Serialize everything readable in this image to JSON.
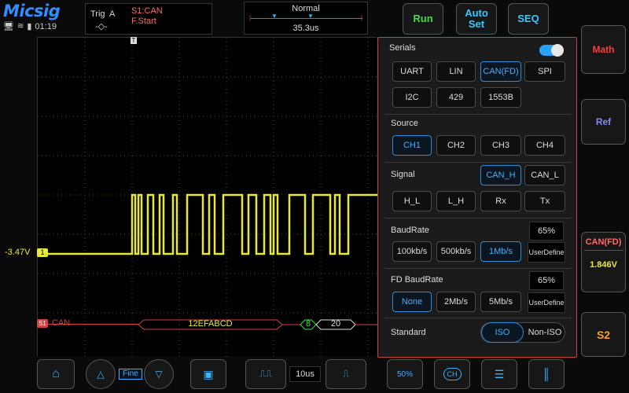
{
  "header": {
    "logo": "Micsig",
    "time": "01:19",
    "trigger": {
      "label": "Trig",
      "channel": "A",
      "source": "S1:CAN",
      "condition": "F.Start"
    },
    "timebase": {
      "mode": "Normal",
      "position": "35.3us"
    },
    "run_label": "Run",
    "autoset_label": "Auto\nSet",
    "seq_label": "SEQ"
  },
  "scope": {
    "ch1_offset": "-3.47V",
    "ch1_marker": "1",
    "serial_marker": "S1",
    "serial_name": "CAN",
    "decode": [
      "12EFABCD",
      "8",
      "20"
    ],
    "trigger_marker": "T"
  },
  "right": {
    "math": "Math",
    "ref": "Ref",
    "can_label": "CAN(FD)",
    "can_value": "1.846V",
    "s2": "S2"
  },
  "panel": {
    "serials_title": "Serials",
    "serials": [
      "UART",
      "LIN",
      "CAN(FD)",
      "SPI",
      "I2C",
      "429",
      "1553B"
    ],
    "source_title": "Source",
    "sources": [
      "CH1",
      "CH2",
      "CH3",
      "CH4"
    ],
    "signal_title": "Signal",
    "signals_top": [
      "CAN_H",
      "CAN_L"
    ],
    "signals_bottom": [
      "H_L",
      "L_H",
      "Rx",
      "Tx"
    ],
    "baud_title": "BaudRate",
    "baud_percent": "65%",
    "bauds": [
      "100kb/s",
      "500kb/s",
      "1Mb/s"
    ],
    "user_define": "UserDefine",
    "fd_title": "FD BaudRate",
    "fd_percent": "65%",
    "fd_bauds": [
      "None",
      "2Mb/s",
      "5Mb/s"
    ],
    "fd_user_define": "UserDefine",
    "standard_title": "Standard",
    "standards": [
      "ISO",
      "Non-ISO"
    ]
  },
  "bottom": {
    "fine": "Fine",
    "timebase": "10us",
    "fifty": "50%",
    "ch_icon": "CH"
  }
}
